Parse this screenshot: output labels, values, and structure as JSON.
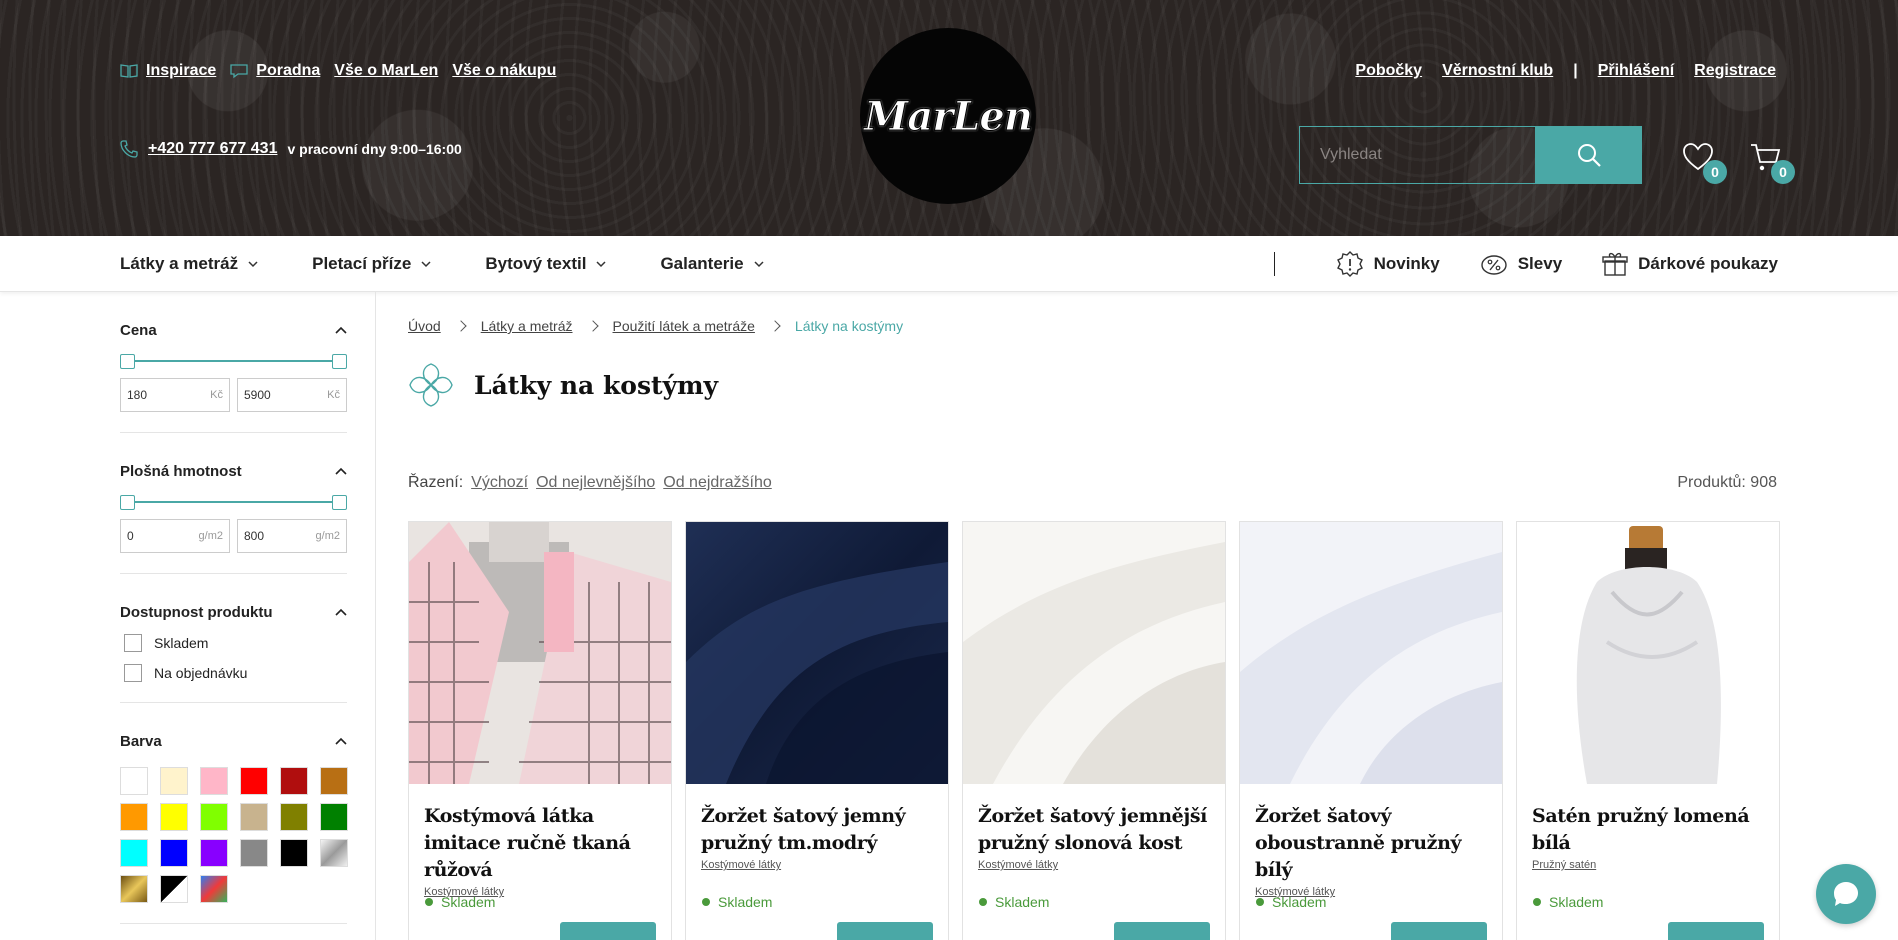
{
  "header": {
    "left_links": [
      {
        "label": "Inspirace",
        "icon": "book-icon"
      },
      {
        "label": "Poradna",
        "icon": "chat-bubble-icon"
      },
      {
        "label": "Vše o MarLen"
      },
      {
        "label": "Vše o nákupu"
      }
    ],
    "right_links": [
      "Pobočky",
      "Věrnostní klub",
      "Přihlášení",
      "Registrace"
    ],
    "divider": "|",
    "phone": "+420 777 677 431",
    "hours": "v pracovní dny 9:00–16:00",
    "logo_text": "MarLen",
    "search_placeholder": "Vyhledat",
    "wishlist_count": "0",
    "cart_count": "0"
  },
  "nav": {
    "categories": [
      "Látky a metráž",
      "Pletací příze",
      "Bytový textil",
      "Galanterie"
    ],
    "specials": [
      {
        "label": "Novinky",
        "icon": "new-badge-icon"
      },
      {
        "label": "Slevy",
        "icon": "discount-tag-icon"
      },
      {
        "label": "Dárkové poukazy",
        "icon": "gift-icon"
      }
    ]
  },
  "filters": {
    "price": {
      "title": "Cena",
      "min": "180",
      "max": "5900",
      "unit": "Kč"
    },
    "weight": {
      "title": "Plošná hmotnost",
      "min": "0",
      "max": "800",
      "unit": "g/m2"
    },
    "availability": {
      "title": "Dostupnost produktu",
      "options": [
        "Skladem",
        "Na objednávku"
      ]
    },
    "color": {
      "title": "Barva",
      "swatches": [
        "#ffffff",
        "#fff3cc",
        "#ffb6c8",
        "#ff0000",
        "#b00e0e",
        "#b86f14",
        "#ff9900",
        "#ffff00",
        "#80ff00",
        "#c8b38e",
        "#808000",
        "#008000",
        "#00ffff",
        "#0000ff",
        "#8800ff",
        "#888888",
        "#000000",
        "silver",
        "gold",
        "blackwhite",
        "multicolor"
      ]
    }
  },
  "breadcrumb": [
    "Úvod",
    "Látky a metráž",
    "Použití látek a metráže",
    "Látky na kostýmy"
  ],
  "page_title": "Látky na kostýmy",
  "sort": {
    "label": "Řazení:",
    "options": [
      "Výchozí",
      "Od nejlevnějšího",
      "Od nejdražšího"
    ]
  },
  "count": "Produktů: 908",
  "products": [
    {
      "name": "Kostýmová látka imitace ručně tkaná růžová",
      "category": "Kostýmové látky",
      "stock": "Skladem"
    },
    {
      "name": "Žoržet šatový jemný pružný tm.modrý",
      "category": "Kostýmové látky",
      "stock": "Skladem"
    },
    {
      "name": "Žoržet šatový jemnější pružný slonová kost",
      "category": "Kostýmové látky",
      "stock": "Skladem"
    },
    {
      "name": "Žoržet šatový oboustranně pružný bílý",
      "category": "Kostýmové látky",
      "stock": "Skladem"
    },
    {
      "name": "Satén pružný lomená bílá",
      "category": "Pružný satén",
      "stock": "Skladem"
    }
  ],
  "colors": {
    "accent": "#4aa8a6",
    "header_bg": "#2b2523",
    "stock_green": "#4a9a3b"
  }
}
